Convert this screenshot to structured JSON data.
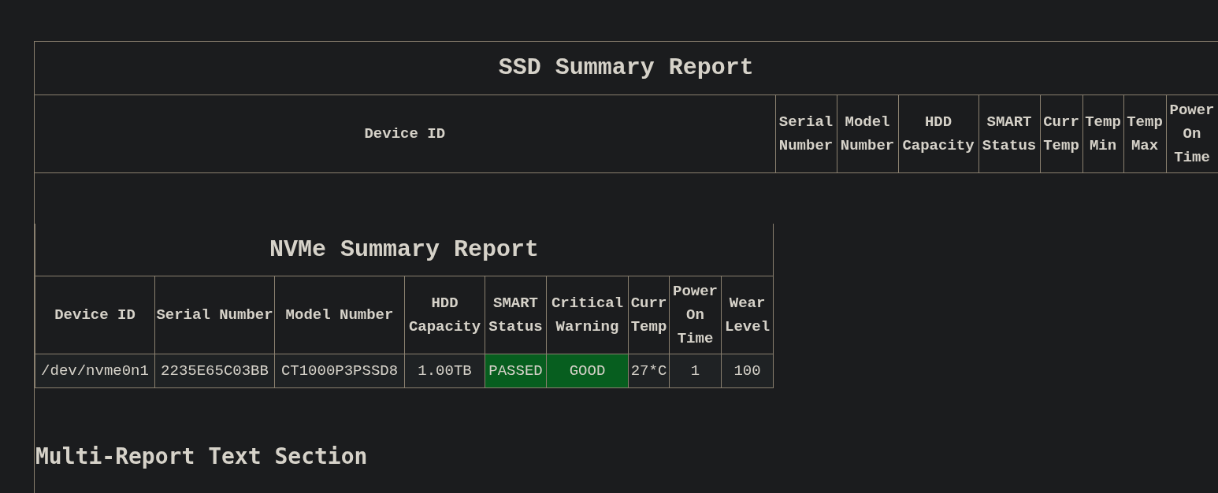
{
  "ssd_report": {
    "title": "SSD Summary Report",
    "columns": [
      "Device ID",
      "Serial Number",
      "Model Number",
      "HDD Capacity",
      "SMART Status",
      "Curr Temp",
      "Temp Min",
      "Temp Max",
      "Power On Time"
    ]
  },
  "nvme_report": {
    "title": "NVMe Summary Report",
    "columns": [
      "Device ID",
      "Serial Number",
      "Model Number",
      "HDD Capacity",
      "SMART Status",
      "Critical Warning",
      "Curr Temp",
      "Power On Time",
      "Wear Level"
    ],
    "rows": [
      {
        "cells": [
          {
            "text": "/dev/nvme0n1"
          },
          {
            "text": "2235E65C03BB"
          },
          {
            "text": "CT1000P3PSSD8"
          },
          {
            "text": "1.00TB"
          },
          {
            "text": "PASSED",
            "color": "#075e1f"
          },
          {
            "text": "GOOD",
            "color": "#075e1f"
          },
          {
            "text": "27*C"
          },
          {
            "text": "1"
          },
          {
            "text": "100"
          }
        ]
      }
    ]
  },
  "section_heading": "Multi-Report Text Section"
}
